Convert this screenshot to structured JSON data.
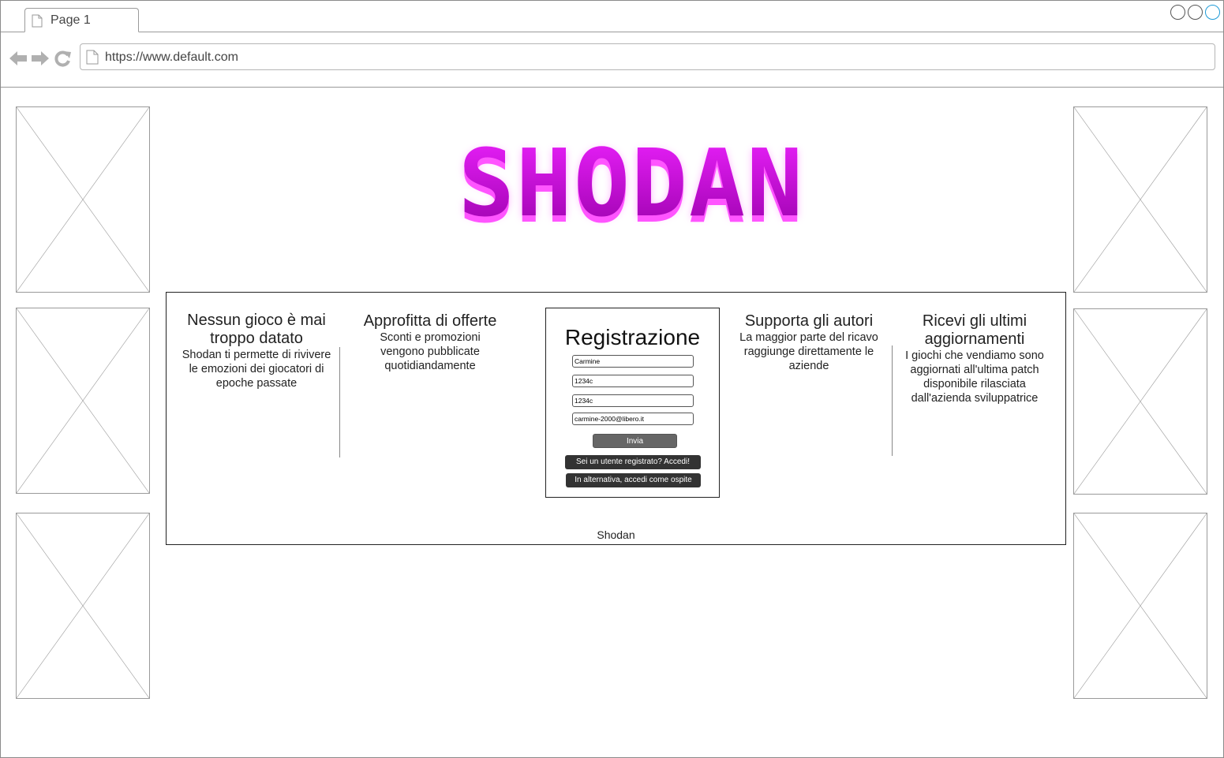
{
  "browser": {
    "tab_label": "Page 1",
    "url": "https://www.default.com"
  },
  "columns": [
    {
      "heading": "Nessun gioco è mai troppo datato",
      "text": "Shodan ti permette di rivivere le emozioni dei giocatori di epoche passate"
    },
    {
      "heading": "Approfitta di offerte",
      "text": "Sconti e promozioni vengono pubblicate quotidiandamente"
    },
    {
      "heading": "Supporta gli autori",
      "text": "La maggior parte del ricavo raggiunge direttamente le aziende"
    },
    {
      "heading": "Ricevi gli ultimi aggiornamenti",
      "text": "I giochi che vendiamo sono aggiornati all'ultima patch disponibile rilasciata dall'azienda sviluppatrice"
    }
  ],
  "registration": {
    "title": "Registrazione",
    "fields": [
      "Carmine",
      "1234c",
      "1234c",
      "carmine-2000@libero.it"
    ],
    "submit_label": "Invia",
    "login_label": "Sei un utente registrato? Accedi!",
    "guest_label": "In alternativa, accedi come ospite"
  },
  "logo": {
    "text": "SHODAN",
    "color": "#cc00dd"
  },
  "footer": {
    "text": "Shodan"
  },
  "colors": {
    "logo_main": "#cc22ee",
    "logo_shadow": "#ff55ff",
    "button_gray": "#666666",
    "button_dark": "#333333"
  }
}
